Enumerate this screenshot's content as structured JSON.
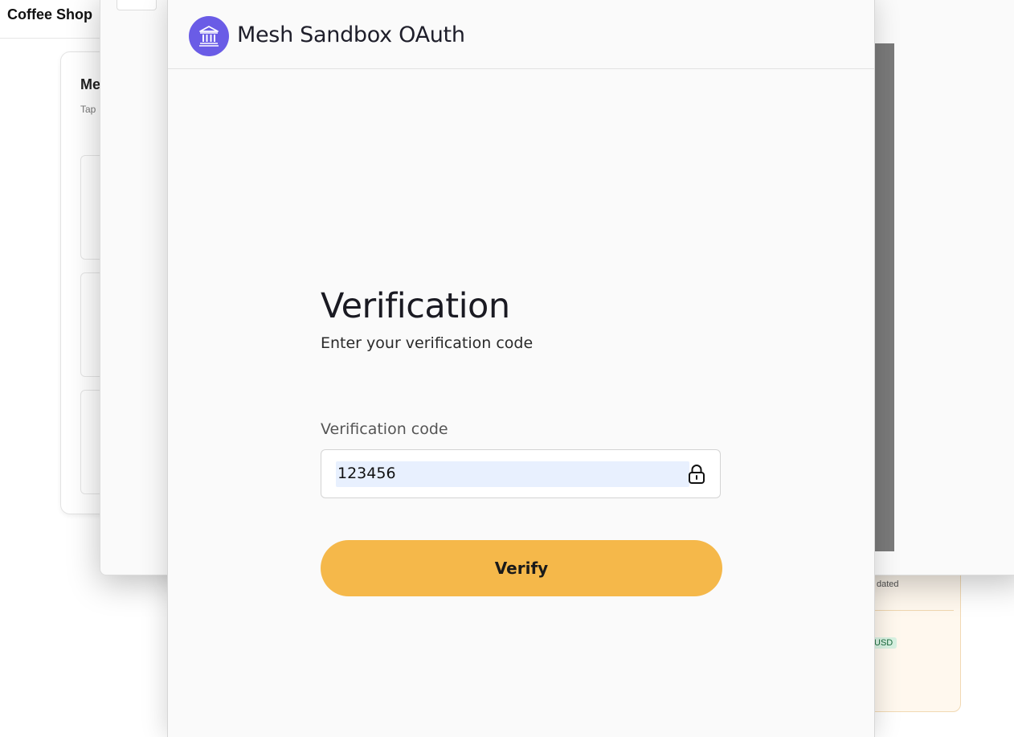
{
  "background_app": {
    "title": "Coffee Shop",
    "card_title": "Me",
    "card_sub": "Tap",
    "updated_text": "dated",
    "currency_badge": "USD"
  },
  "modal": {
    "title": "Mesh Sandbox OAuth",
    "logo_icon": "bank-icon",
    "accent_color": "#6a5ce6"
  },
  "verification": {
    "heading": "Verification",
    "subheading": "Enter your verification code",
    "field_label": "Verification code",
    "code_value": "123456",
    "button_label": "Verify",
    "button_color": "#f5b84a"
  }
}
